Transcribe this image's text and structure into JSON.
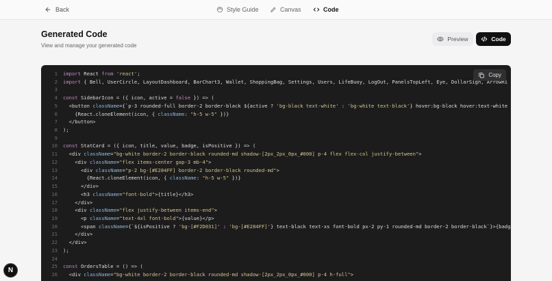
{
  "topbar": {
    "back_label": "Back",
    "nav": [
      {
        "label": "Style Guide",
        "icon": "palette-icon"
      },
      {
        "label": "Canvas",
        "icon": "pen-icon"
      },
      {
        "label": "Code",
        "icon": "code-icon",
        "active": true
      }
    ]
  },
  "header": {
    "title": "Generated Code",
    "subtitle": "View and manage your generated code",
    "preview_label": "Preview",
    "code_label": "Code"
  },
  "code": {
    "copy_label": "Copy",
    "lines": [
      "import React from 'react';",
      "import { Bell, UserCircle, LayoutDashboard, BarChart3, Wallet, ShoppingBag, Settings, Users, LifeBuoy, LogOut, PanelsTopLeft, Eye, DollarSign, ArrowRi",
      "",
      "const SidebarIcon = ({ icon, active = false }) => (",
      "  <button className={`p-3 rounded-full border-2 border-black ${active ? 'bg-black text-white' : 'bg-white text-black'} hover:bg-black hover:text-white",
      "    {React.cloneElement(icon, { className: \"h-5 w-5\" })}",
      "  </button>",
      ");",
      "",
      "const StatCard = ({ icon, title, value, badge, isPositive }) => (",
      "  <div className=\"bg-white border-2 border-black rounded-md shadow-[2px_2px_0px_#000] p-4 flex flex-col justify-between\">",
      "    <div className=\"flex items-center gap-3 mb-4\">",
      "      <div className=\"p-2 bg-[#E284FF] border-2 border-black rounded-md\">",
      "        {React.cloneElement(icon, { className: \"h-5 w-5\" })}",
      "      </div>",
      "      <h3 className=\"font-bold\">{title}</h3>",
      "    </div>",
      "    <div className=\"flex justify-between items-end\">",
      "      <p className=\"text-4xl font-bold\">{value}</p>",
      "      <span className={`${isPositive ? 'bg-[#F2D031]' : 'bg-[#E284FF]'} text-black text-xs font-bold px-2 py-1 rounded-md border-2 border-black`}>{badg",
      "    </div>",
      "  </div>",
      ");",
      "",
      "const OrdersTable = () => (",
      "  <div className=\"bg-white border-2 border-black rounded-md shadow-[2px_2px_0px_#000] p-4 h-full\">"
    ]
  },
  "user": {
    "avatar_initial": "N"
  }
}
